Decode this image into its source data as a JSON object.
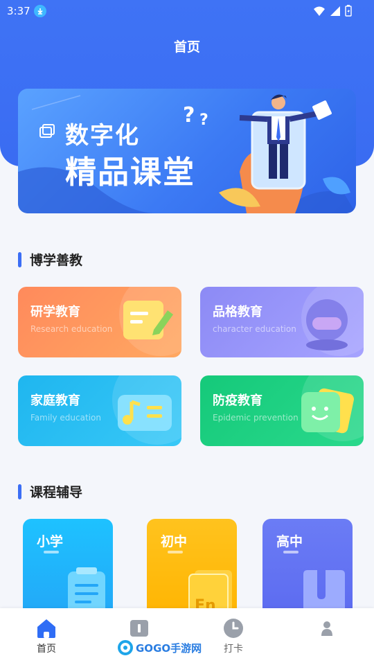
{
  "status_bar": {
    "time": "3:37"
  },
  "header": {
    "title": "首页"
  },
  "banner": {
    "line1": "数字化",
    "line2": "精品课堂"
  },
  "section1": {
    "title": "博学善教",
    "cards": [
      {
        "title": "研学教育",
        "subtitle": "Research education"
      },
      {
        "title": "品格教育",
        "subtitle": "character education"
      },
      {
        "title": "家庭教育",
        "subtitle": "Family education"
      },
      {
        "title": "防疫教育",
        "subtitle": "Epidemic prevention"
      }
    ]
  },
  "section2": {
    "title": "课程辅导",
    "courses": [
      {
        "title": "小学"
      },
      {
        "title": "初中",
        "badge": "En"
      },
      {
        "title": "高中"
      }
    ]
  },
  "bottom_nav": {
    "items": [
      {
        "label": "首页",
        "icon": "home-icon"
      },
      {
        "label": "",
        "icon": "book-icon"
      },
      {
        "label": "打卡",
        "icon": "clock-icon"
      },
      {
        "label": "",
        "icon": "user-icon"
      }
    ]
  },
  "watermark": {
    "text": "GOGO手游网"
  }
}
